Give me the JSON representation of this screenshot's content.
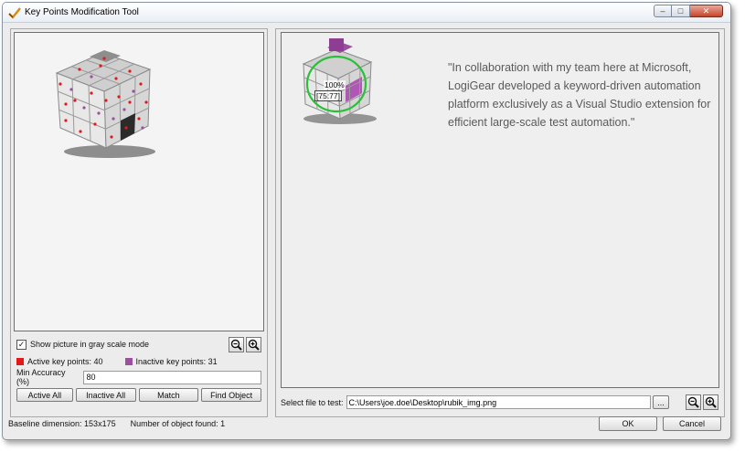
{
  "window": {
    "title": "Key Points Modification Tool",
    "controls": {
      "minimize": "–",
      "maximize": "□",
      "close": "✕"
    }
  },
  "left": {
    "gray_scale_label": "Show picture in gray scale mode",
    "gray_scale_checked": true,
    "active_key_points": "Active key points: 40",
    "inactive_key_points": "Inactive key points: 31",
    "min_accuracy_label": "Min Accuracy (%)",
    "min_accuracy_value": "80",
    "buttons": {
      "active_all": "Active All",
      "inactive_all": "Inactive All",
      "match": "Match",
      "find_object": "Find Object"
    },
    "colors": {
      "active": "#e0191b",
      "inactive": "#9b4f9e"
    }
  },
  "right": {
    "quote": "\"In collaboration with my team here at Microsoft, LogiGear developed a keyword-driven automation platform exclusively as a Visual Studio extension for efficient large-scale test automation.\"",
    "match_percent": "100%",
    "match_coords": "[75:77]",
    "file_label": "Select file to test:",
    "file_path": "C:\\Users\\joe.doe\\Desktop\\rubik_img.png",
    "browse_label": "..."
  },
  "status": {
    "baseline": "Baseline dimension: 153x175",
    "found": "Number of object found: 1"
  },
  "dialog": {
    "ok": "OK",
    "cancel": "Cancel"
  }
}
